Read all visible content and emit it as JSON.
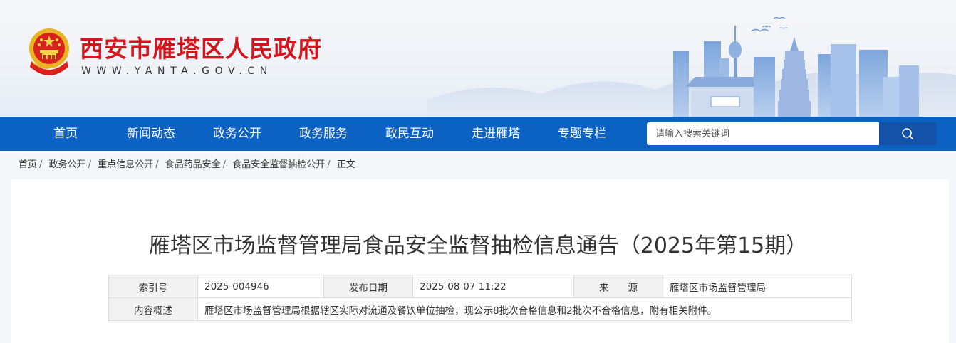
{
  "header": {
    "site_title": "西安市雁塔区人民政府",
    "site_url": "WWW.YANTA.GOV.CN",
    "brand_color": "#d5141c"
  },
  "nav": {
    "items": [
      "首页",
      "新闻动态",
      "政务公开",
      "政务服务",
      "政民互动",
      "走进雁塔",
      "专题专栏"
    ],
    "background": "#0b62c3",
    "search_placeholder": "请输入搜索关键词",
    "search_icon": "search-icon"
  },
  "breadcrumb": [
    "首页",
    "政务公开",
    "重点信息公开",
    "食品药品安全",
    "食品安全监督抽检公开",
    "正文"
  ],
  "article": {
    "title": "雁塔区市场监督管理局食品安全监督抽检信息通告（2025年第15期）",
    "meta": {
      "index_label": "索引号",
      "index_value": "2025-004946",
      "date_label": "发布日期",
      "date_value": "2025-08-07 11:22",
      "source_label": "来　　源",
      "source_value": "雁塔区市场监督管理局",
      "summary_label": "内容概述",
      "summary_value": "雁塔区市场监督管理局根据辖区实际对流通及餐饮单位抽检，现公示8批次合格信息和2批次不合格信息，附有相关附件。"
    }
  }
}
